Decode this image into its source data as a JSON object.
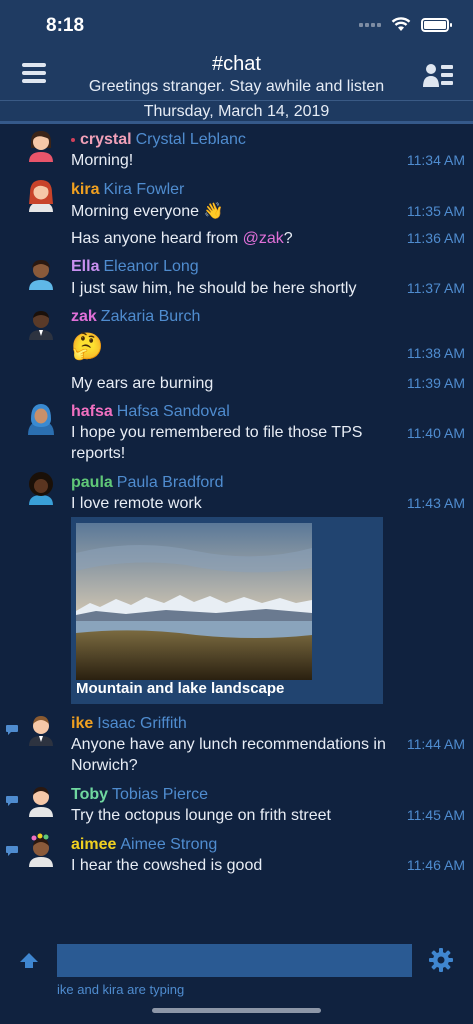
{
  "status": {
    "time": "8:18"
  },
  "header": {
    "channel": "#chat",
    "topic": "Greetings stranger. Stay awhile and listen"
  },
  "date_divider": "Thursday, March 14, 2019",
  "messages": [
    {
      "nick": "crystal",
      "realname": "Crystal Leblanc",
      "nick_color": "#f0a0b8",
      "lines": [
        {
          "text": "Morning!",
          "time": "11:34 AM"
        }
      ]
    },
    {
      "nick": "kira",
      "realname": "Kira Fowler",
      "nick_color": "#f0a020",
      "lines": [
        {
          "text": "Morning everyone 👋",
          "time": "11:35 AM"
        },
        {
          "text_before": "Has anyone heard from ",
          "mention": "@zak",
          "text_after": "?",
          "time": "11:36 AM"
        }
      ]
    },
    {
      "nick": "Ella",
      "realname": "Eleanor Long",
      "nick_color": "#c890f0",
      "lines": [
        {
          "text": "I just saw him, he should be here shortly",
          "time": "11:37 AM"
        }
      ]
    },
    {
      "nick": "zak",
      "realname": "Zakaria Burch",
      "nick_color": "#e070d8",
      "lines": [
        {
          "text": "🤔",
          "time": "11:38 AM"
        },
        {
          "text": "My ears are burning",
          "time": "11:39 AM"
        }
      ]
    },
    {
      "nick": "hafsa",
      "realname": "Hafsa Sandoval",
      "nick_color": "#f070c0",
      "lines": [
        {
          "text": "I hope you remembered to file those TPS reports!",
          "time": "11:40 AM"
        }
      ]
    },
    {
      "nick": "paula",
      "realname": "Paula Bradford",
      "nick_color": "#60c878",
      "lines": [
        {
          "text": "I love remote work",
          "time": "11:43 AM"
        }
      ],
      "image_caption": "Mountain and lake landscape"
    },
    {
      "nick": "ike",
      "realname": "Isaac Griffith",
      "nick_color": "#f0a020",
      "lines": [
        {
          "text": "Anyone have any lunch recommendations in Norwich?",
          "time": "11:44 AM"
        }
      ]
    },
    {
      "nick": "Toby",
      "realname": "Tobias Pierce",
      "nick_color": "#70d8a0",
      "lines": [
        {
          "text": "Try the octopus lounge on frith street",
          "time": "11:45 AM"
        }
      ]
    },
    {
      "nick": "aimee",
      "realname": "Aimee Strong",
      "nick_color": "#f0d020",
      "lines": [
        {
          "text": "I hear the cowshed is good",
          "time": "11:46 AM"
        }
      ]
    }
  ],
  "composer": {
    "placeholder": "",
    "typing": "ike and kira are typing"
  }
}
